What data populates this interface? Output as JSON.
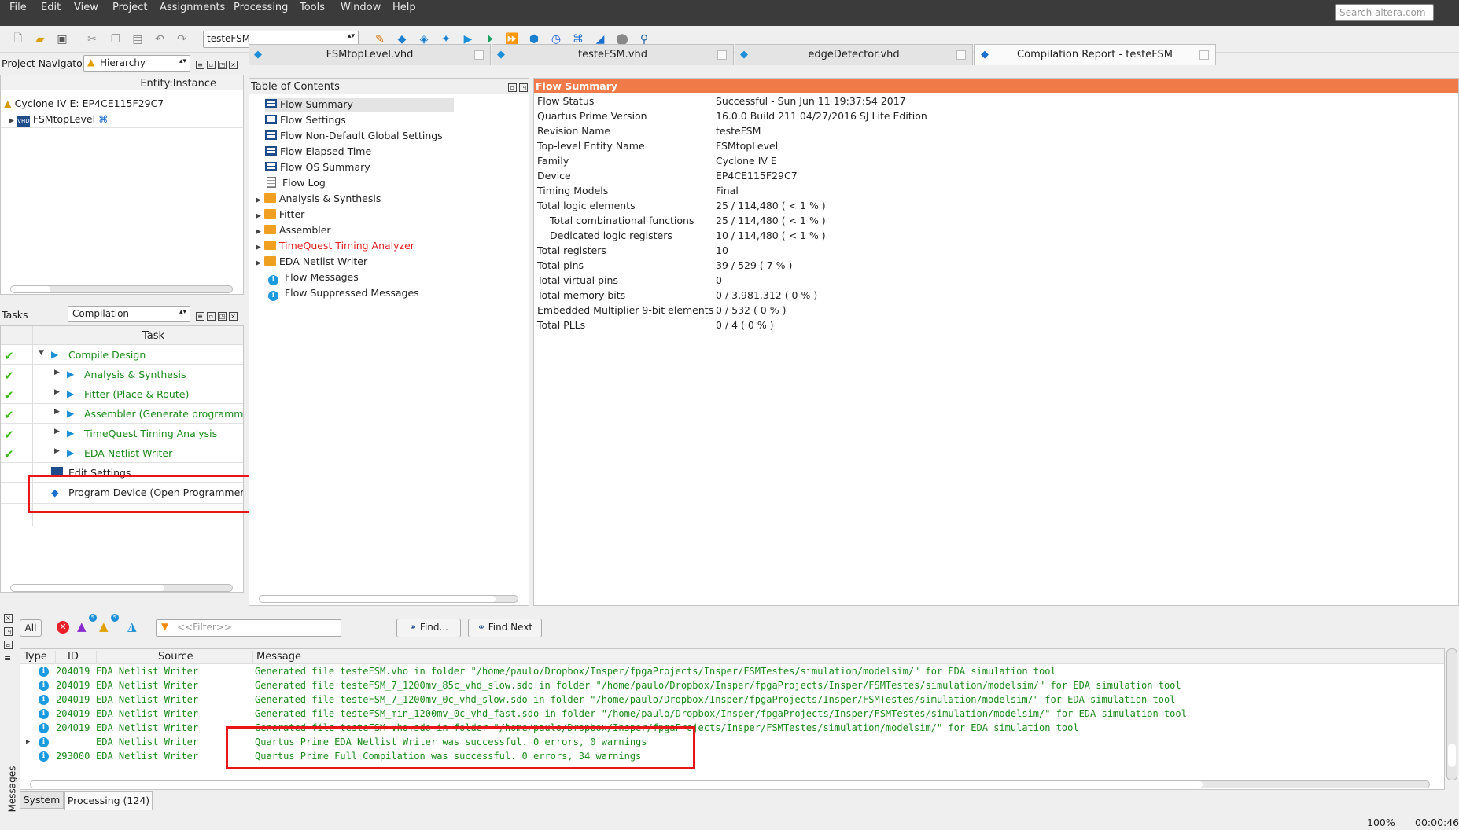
{
  "menu": [
    "File",
    "Edit",
    "View",
    "Project",
    "Assignments",
    "Processing",
    "Tools",
    "Window",
    "Help"
  ],
  "search_placeholder": "Search altera.com",
  "revision": "testeFSM",
  "navigator": {
    "label": "Project Navigator",
    "mode": "Hierarchy",
    "col_header": "Entity:Instance",
    "device": "Cyclone IV E: EP4CE115F29C7",
    "top_entity": "FSMtopLevel"
  },
  "tasks": {
    "label": "Tasks",
    "mode": "Compilation",
    "col_header": "Task",
    "items": [
      {
        "label": "Compile Design",
        "status": "done"
      },
      {
        "label": "Analysis & Synthesis",
        "status": "done"
      },
      {
        "label": "Fitter (Place & Route)",
        "status": "done"
      },
      {
        "label": "Assembler (Generate programming",
        "status": "done"
      },
      {
        "label": "TimeQuest Timing Analysis",
        "status": "done"
      },
      {
        "label": "EDA Netlist Writer",
        "status": "done"
      },
      {
        "label": "Edit Settings",
        "status": ""
      },
      {
        "label": "Program Device (Open Programmer)",
        "status": ""
      }
    ]
  },
  "tabs": [
    "FSMtopLevel.vhd",
    "testeFSM.vhd",
    "edgeDetector.vhd",
    "Compilation Report - testeFSM"
  ],
  "toc": {
    "label": "Table of Contents",
    "items": [
      "Flow Summary",
      "Flow Settings",
      "Flow Non-Default Global Settings",
      "Flow Elapsed Time",
      "Flow OS Summary",
      "Flow Log",
      "Analysis & Synthesis",
      "Fitter",
      "Assembler",
      "TimeQuest Timing Analyzer",
      "EDA Netlist Writer",
      "Flow Messages",
      "Flow Suppressed Messages"
    ]
  },
  "summary": {
    "title": "Flow Summary",
    "rows": [
      [
        "Flow Status",
        "Successful - Sun Jun 11 19:37:54 2017"
      ],
      [
        "Quartus Prime Version",
        "16.0.0 Build 211 04/27/2016 SJ Lite Edition"
      ],
      [
        "Revision Name",
        "testeFSM"
      ],
      [
        "Top-level Entity Name",
        "FSMtopLevel"
      ],
      [
        "Family",
        "Cyclone IV E"
      ],
      [
        "Device",
        "EP4CE115F29C7"
      ],
      [
        "Timing Models",
        "Final"
      ],
      [
        "Total logic elements",
        "25 / 114,480 ( < 1 % )"
      ],
      [
        "Total combinational functions",
        "25 / 114,480 ( < 1 % )"
      ],
      [
        "Dedicated logic registers",
        "10 / 114,480 ( < 1 % )"
      ],
      [
        "Total registers",
        "10"
      ],
      [
        "Total pins",
        "39 / 529 ( 7 % )"
      ],
      [
        "Total virtual pins",
        "0"
      ],
      [
        "Total memory bits",
        "0 / 3,981,312 ( 0 % )"
      ],
      [
        "Embedded Multiplier 9-bit elements",
        "0 / 532 ( 0 % )"
      ],
      [
        "Total PLLs",
        "0 / 4 ( 0 % )"
      ]
    ]
  },
  "messages": {
    "all_label": "All",
    "badge1": "5",
    "badge2": "5",
    "filter_placeholder": "<<Filter>>",
    "find_label": "Find...",
    "find_next_label": "Find Next",
    "cols": [
      "Type",
      "ID",
      "Source",
      "Message"
    ],
    "rows": [
      [
        "204019",
        "EDA Netlist Writer",
        "Generated file testeFSM.vho in folder \"/home/paulo/Dropbox/Insper/fpgaProjects/Insper/FSMTestes/simulation/modelsim/\" for EDA simulation tool"
      ],
      [
        "204019",
        "EDA Netlist Writer",
        "Generated file testeFSM_7_1200mv_85c_vhd_slow.sdo in folder \"/home/paulo/Dropbox/Insper/fpgaProjects/Insper/FSMTestes/simulation/modelsim/\" for EDA simulation tool"
      ],
      [
        "204019",
        "EDA Netlist Writer",
        "Generated file testeFSM_7_1200mv_0c_vhd_slow.sdo in folder \"/home/paulo/Dropbox/Insper/fpgaProjects/Insper/FSMTestes/simulation/modelsim/\" for EDA simulation tool"
      ],
      [
        "204019",
        "EDA Netlist Writer",
        "Generated file testeFSM_min_1200mv_0c_vhd_fast.sdo in folder \"/home/paulo/Dropbox/Insper/fpgaProjects/Insper/FSMTestes/simulation/modelsim/\" for EDA simulation tool"
      ],
      [
        "204019",
        "EDA Netlist Writer",
        "Generated file testeFSM_vhd.sdo in folder \"/home/paulo/Dropbox/Insper/fpgaProjects/Insper/FSMTestes/simulation/modelsim/\" for EDA simulation tool"
      ],
      [
        "",
        "EDA Netlist Writer",
        "Quartus Prime EDA Netlist Writer was successful. 0 errors, 0 warnings"
      ],
      [
        "293000",
        "EDA Netlist Writer",
        "Quartus Prime Full Compilation was successful. 0 errors, 34 warnings"
      ]
    ],
    "side_label": "Messages",
    "tab_system": "System",
    "tab_processing": "Processing (124)"
  },
  "status": {
    "zoom": "100%",
    "time": "00:00:46"
  }
}
